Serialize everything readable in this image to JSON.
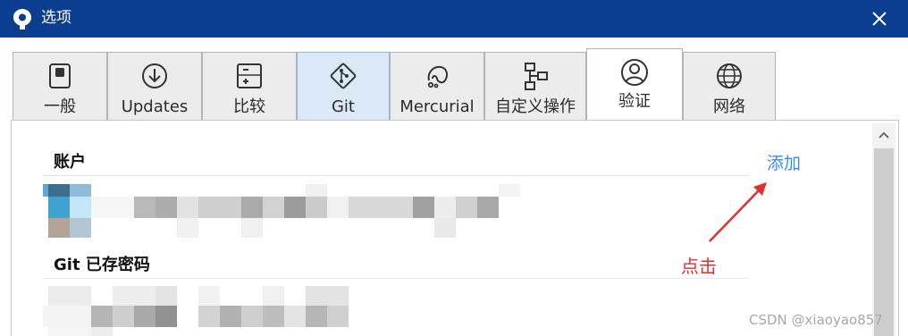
{
  "window": {
    "title": "选项",
    "icon": "sourcetree-logo-icon",
    "close_icon": "close-icon"
  },
  "tabs": [
    {
      "label": "一般",
      "icon": "switch-icon"
    },
    {
      "label": "Updates",
      "icon": "download-circle-icon"
    },
    {
      "label": "比较",
      "icon": "plus-minus-icon"
    },
    {
      "label": "Git",
      "icon": "git-branch-icon",
      "highlighted": true
    },
    {
      "label": "Mercurial",
      "icon": "mercurial-icon"
    },
    {
      "label": "自定义操作",
      "icon": "flowchart-icon"
    },
    {
      "label": "验证",
      "icon": "user-circle-icon",
      "active": true
    },
    {
      "label": "网络",
      "icon": "globe-icon"
    }
  ],
  "sections": {
    "accounts_header": "账户",
    "git_passwords_header": "Git 已存密码"
  },
  "actions": {
    "add_label": "添加"
  },
  "annotation": {
    "text": "点击",
    "color": "#e03030"
  },
  "watermark": "CSDN @xiaoyao857",
  "colors": {
    "titlebar": "#0b3d91",
    "link": "#3a8ee6",
    "git_tab": "#dbe9f7"
  }
}
